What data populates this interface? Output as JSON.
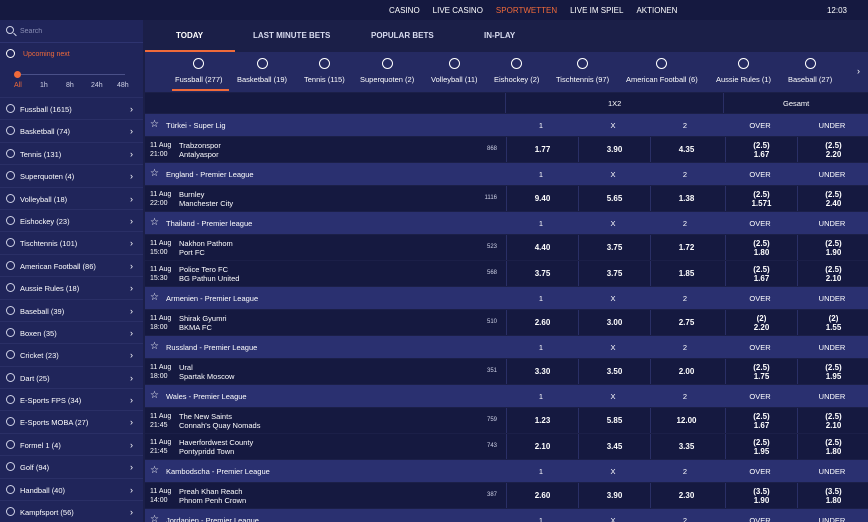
{
  "topnav": {
    "items": [
      "CASINO",
      "LIVE CASINO",
      "SPORTWETTEN",
      "LIVE IM SPIEL",
      "AKTIONEN"
    ],
    "active": "SPORTWETTEN",
    "time": "12:03"
  },
  "sidebar": {
    "search_placeholder": "Search",
    "upcoming_label": "Upcoming next",
    "slider_labels": [
      "All",
      "1h",
      "8h",
      "24h",
      "48h"
    ],
    "sports": [
      "Fussball (1615)",
      "Basketball (74)",
      "Tennis (131)",
      "Superquoten (4)",
      "Volleyball (18)",
      "Eishockey (23)",
      "Tischtennis (101)",
      "American Football (86)",
      "Aussie Rules (18)",
      "Baseball (39)",
      "Boxen (35)",
      "Cricket (23)",
      "Dart (25)",
      "E-Sports FPS (34)",
      "E-Sports MOBA (27)",
      "Formel 1 (4)",
      "Golf (94)",
      "Handball (40)",
      "Kampfsport (56)"
    ]
  },
  "tabs": [
    "TODAY",
    "LAST MINUTE BETS",
    "POPULAR BETS",
    "IN-PLAY"
  ],
  "sportbar": [
    "Fussball (277)",
    "Basketball (19)",
    "Tennis (115)",
    "Superquoten (2)",
    "Volleyball (11)",
    "Eishockey (2)",
    "Tischtennis (97)",
    "American Football (6)",
    "Aussie Rules (1)",
    "Baseball (27)"
  ],
  "table": {
    "group_1x2": "1X2",
    "group_total": "Gesamt",
    "cols": {
      "one": "1",
      "x": "X",
      "two": "2",
      "over": "OVER",
      "under": "UNDER"
    },
    "leagues": [
      {
        "name": "Türkei - Super Lig",
        "matches": [
          {
            "date": "11 Aug",
            "time": "21:00",
            "home": "Trabzonspor",
            "away": "Antalyaspor",
            "id": "868",
            "o1": "1.77",
            "ox": "3.90",
            "o2": "4.35",
            "over_line": "(2.5)",
            "over": "1.67",
            "under_line": "(2.5)",
            "under": "2.20"
          }
        ]
      },
      {
        "name": "England - Premier League",
        "matches": [
          {
            "date": "11 Aug",
            "time": "22:00",
            "home": "Burnley",
            "away": "Manchester City",
            "id": "1116",
            "o1": "9.40",
            "ox": "5.65",
            "o2": "1.38",
            "over_line": "(2.5)",
            "over": "1.571",
            "under_line": "(2.5)",
            "under": "2.40"
          }
        ]
      },
      {
        "name": "Thailand - Premier league",
        "matches": [
          {
            "date": "11 Aug",
            "time": "15:00",
            "home": "Nakhon Pathom",
            "away": "Port FC",
            "id": "523",
            "o1": "4.40",
            "ox": "3.75",
            "o2": "1.72",
            "over_line": "(2.5)",
            "over": "1.80",
            "under_line": "(2.5)",
            "under": "1.90"
          },
          {
            "date": "11 Aug",
            "time": "15:30",
            "home": "Police Tero FC",
            "away": "BG Pathun United",
            "id": "568",
            "o1": "3.75",
            "ox": "3.75",
            "o2": "1.85",
            "over_line": "(2.5)",
            "over": "1.67",
            "under_line": "(2.5)",
            "under": "2.10"
          }
        ]
      },
      {
        "name": "Armenien - Premier League",
        "matches": [
          {
            "date": "11 Aug",
            "time": "18:00",
            "home": "Shirak Gyumri",
            "away": "BKMA FC",
            "id": "510",
            "o1": "2.60",
            "ox": "3.00",
            "o2": "2.75",
            "over_line": "(2)",
            "over": "2.20",
            "under_line": "(2)",
            "under": "1.55"
          }
        ]
      },
      {
        "name": "Russland - Premier League",
        "matches": [
          {
            "date": "11 Aug",
            "time": "18:00",
            "home": "Ural",
            "away": "Spartak Moscow",
            "id": "351",
            "o1": "3.30",
            "ox": "3.50",
            "o2": "2.00",
            "over_line": "(2.5)",
            "over": "1.75",
            "under_line": "(2.5)",
            "under": "1.95"
          }
        ]
      },
      {
        "name": "Wales - Premier League",
        "matches": [
          {
            "date": "11 Aug",
            "time": "21:45",
            "home": "The New Saints",
            "away": "Connah's Quay Nomads",
            "id": "759",
            "o1": "1.23",
            "ox": "5.85",
            "o2": "12.00",
            "over_line": "(2.5)",
            "over": "1.67",
            "under_line": "(2.5)",
            "under": "2.10"
          },
          {
            "date": "11 Aug",
            "time": "21:45",
            "home": "Haverfordwest County",
            "away": "Pontypridd Town",
            "id": "743",
            "o1": "2.10",
            "ox": "3.45",
            "o2": "3.35",
            "over_line": "(2.5)",
            "over": "1.95",
            "under_line": "(2.5)",
            "under": "1.80"
          }
        ]
      },
      {
        "name": "Kambodscha - Premier League",
        "matches": [
          {
            "date": "11 Aug",
            "time": "14:00",
            "home": "Preah Khan Reach",
            "away": "Phnom Penh Crown",
            "id": "387",
            "o1": "2.60",
            "ox": "3.90",
            "o2": "2.30",
            "over_line": "(3.5)",
            "over": "1.90",
            "under_line": "(3.5)",
            "under": "1.80"
          }
        ]
      },
      {
        "name": "Jordanien - Premier League",
        "matches": []
      }
    ]
  }
}
